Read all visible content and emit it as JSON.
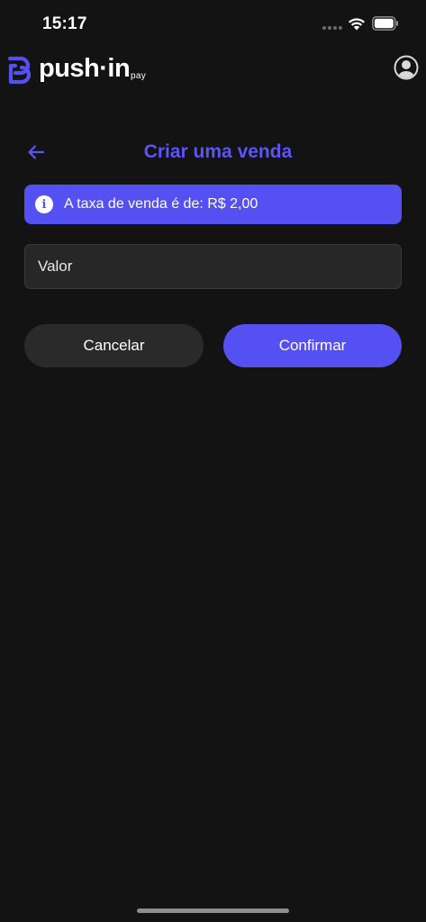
{
  "status_bar": {
    "time": "15:17"
  },
  "header": {
    "logo_word": "push·in",
    "logo_sub": "pay"
  },
  "page": {
    "title": "Criar uma venda"
  },
  "info_banner": {
    "text": "A taxa de venda é de: R$ 2,00"
  },
  "form": {
    "value_placeholder": "Valor",
    "value": ""
  },
  "actions": {
    "cancel_label": "Cancelar",
    "confirm_label": "Confirmar"
  },
  "icons": {
    "back": "arrow-left-icon",
    "info": "info-icon",
    "profile": "user-circle-icon",
    "wifi": "wifi-icon",
    "battery": "battery-icon"
  },
  "colors": {
    "background": "#131313",
    "accent": "#5550f2",
    "title": "#5b55f5",
    "input_bg": "#272727",
    "cancel_bg": "#2a2a2a"
  }
}
